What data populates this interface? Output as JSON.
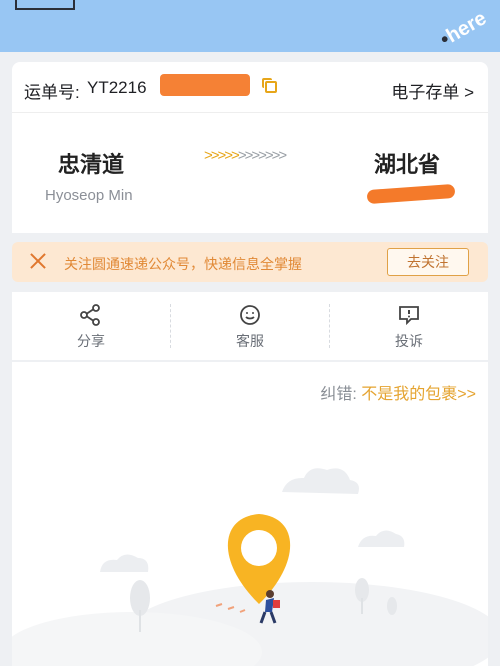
{
  "watermark": "here",
  "waybill": {
    "label": "运单号:",
    "number_visible": "YT2216",
    "eslip_label": "电子存单 >"
  },
  "route": {
    "from_city": "忠清道",
    "from_name": "Hyoseop Min",
    "to_province": "湖北省"
  },
  "notice": {
    "text": "关注圆通速递公众号，快递信息全掌握",
    "button": "去关注"
  },
  "actions": [
    {
      "label": "分享",
      "icon": "share-icon"
    },
    {
      "label": "客服",
      "icon": "customer-service-icon"
    },
    {
      "label": "投诉",
      "icon": "complaint-icon"
    }
  ],
  "correction": {
    "prefix": "纠错:",
    "link": "不是我的包裹>>"
  },
  "colors": {
    "topbar": "#98c6f3",
    "accent": "#e7a61a",
    "redaction": "#f47a2a",
    "banner_bg": "#fde8d2"
  }
}
